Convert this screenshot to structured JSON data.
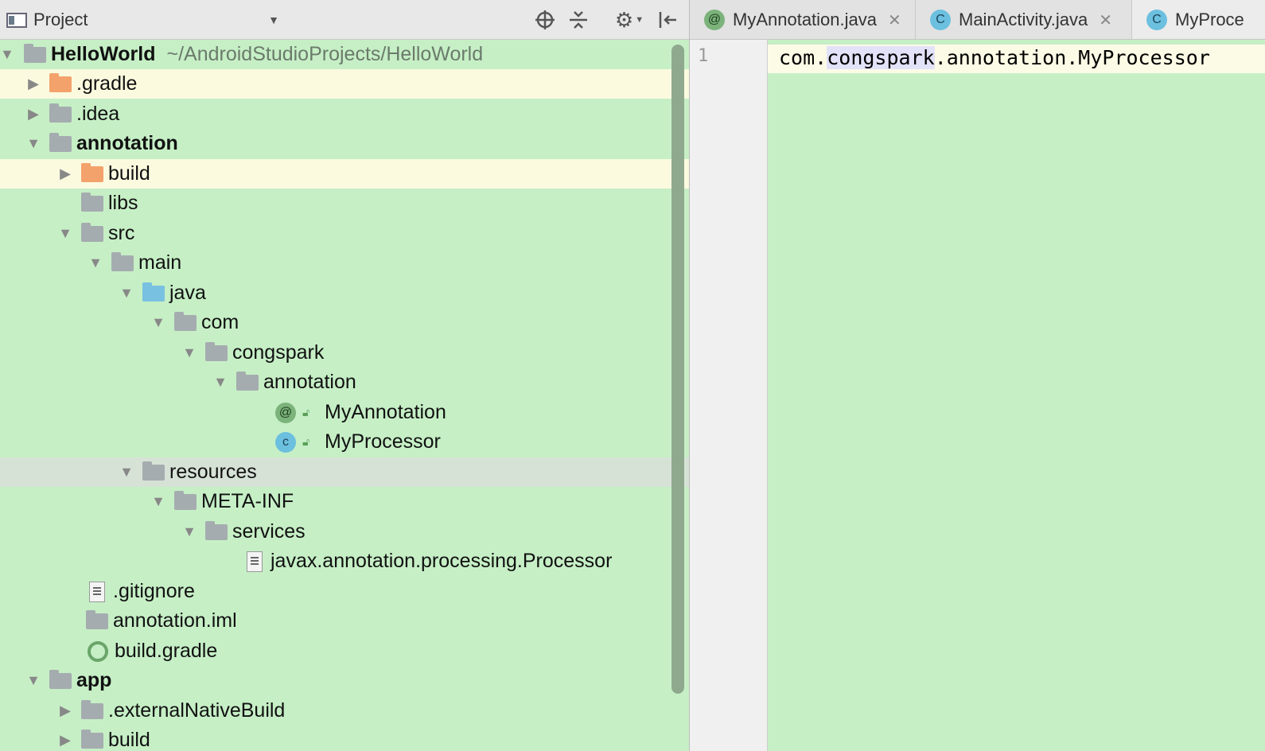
{
  "project_panel": {
    "title": "Project",
    "dropdown_icon": "chevron-down-icon",
    "tools": [
      "locate-icon",
      "collapse-icon",
      "gear-icon",
      "hide-icon"
    ]
  },
  "tree": [
    {
      "label": "HelloWorld",
      "extra": "~/AndroidStudioProjects/HelloWorld",
      "bold": true
    },
    {
      "label": ".gradle"
    },
    {
      "label": ".idea"
    },
    {
      "label": "annotation",
      "bold": true
    },
    {
      "label": "build"
    },
    {
      "label": "libs"
    },
    {
      "label": "src"
    },
    {
      "label": "main"
    },
    {
      "label": "java"
    },
    {
      "label": "com"
    },
    {
      "label": "congspark"
    },
    {
      "label": "annotation"
    },
    {
      "label": "MyAnnotation"
    },
    {
      "label": "MyProcessor"
    },
    {
      "label": "resources"
    },
    {
      "label": "META-INF"
    },
    {
      "label": "services"
    },
    {
      "label": "javax.annotation.processing.Processor"
    },
    {
      "label": ".gitignore"
    },
    {
      "label": "annotation.iml"
    },
    {
      "label": "build.gradle"
    },
    {
      "label": "app",
      "bold": true
    },
    {
      "label": ".externalNativeBuild"
    },
    {
      "label": "build"
    }
  ],
  "tabs": [
    {
      "label": "MyAnnotation.java",
      "icon": "@"
    },
    {
      "label": "MainActivity.java",
      "icon": "C"
    },
    {
      "label": "MyProce",
      "icon": "C"
    }
  ],
  "editor": {
    "line_number": "1",
    "code_before": "com.",
    "code_highlight": "congspark",
    "code_after": ".annotation.MyProcessor"
  },
  "colors": {
    "panel_bg": "#c6efc6",
    "row_highlight": "#fbfadf",
    "selected_row": "#d6e2d6"
  }
}
